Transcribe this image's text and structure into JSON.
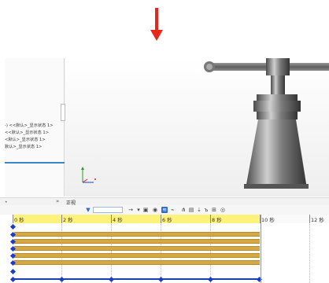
{
  "tree": {
    "items": [
      "-) <<默认>_显示状态 1>",
      "<<默认>_显示状态 1>",
      "<默认>_显示状态 1>",
      "默认>_显示状态 1>"
    ]
  },
  "split_bar": {
    "view_label": "正视"
  },
  "timeline": {
    "tick_labels": [
      "0 秒",
      "2 秒",
      "4 秒",
      "6 秒",
      "8 秒",
      "10 秒",
      "12 秒"
    ],
    "selected_range_end_seconds": 10,
    "track_count": 6
  },
  "colors": {
    "accent_arrow": "#e8261c",
    "ruler_selection": "#fff27a",
    "track_bar": "#d4a843",
    "keyframe": "#1d3ec4"
  }
}
